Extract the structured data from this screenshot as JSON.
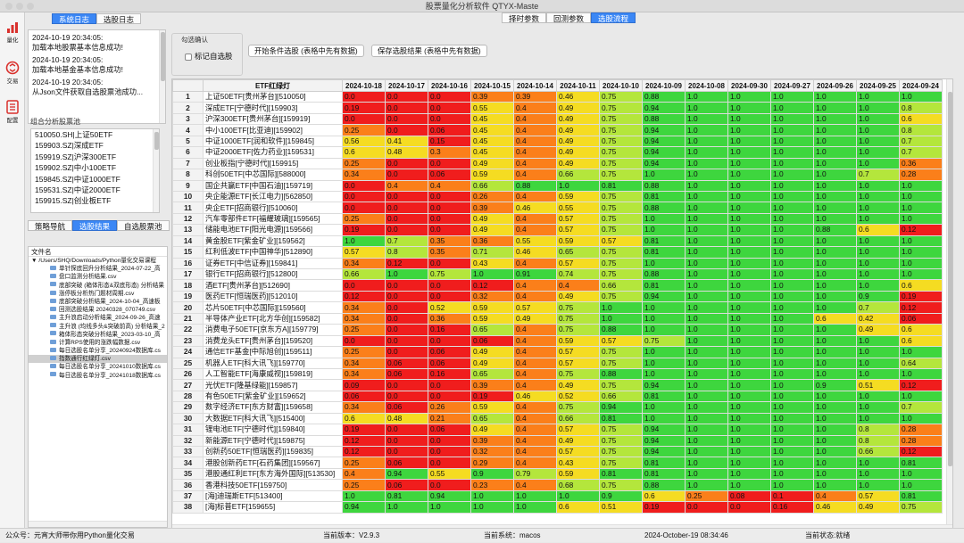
{
  "app": {
    "title": "股票量化分析软件 QTYX-Maste"
  },
  "toolbar": {
    "items": [
      {
        "label": "量化",
        "icon": "bar-chart-icon",
        "color": "#d9302c"
      },
      {
        "label": "交易",
        "icon": "trade-icon",
        "color": "#d9302c"
      },
      {
        "label": "配置",
        "icon": "config-icon",
        "color": "#d9302c"
      }
    ]
  },
  "left_tabs": {
    "tab1": "系统日志",
    "tab2": "选股日志"
  },
  "logs": [
    {
      "time": "2024-10-19 20:34:05:",
      "msg": "加载本地股票基本信息成功!"
    },
    {
      "time": "2024-10-19 20:34:05:",
      "msg": "加载本地基金基本信息成功!"
    },
    {
      "time": "2024-10-19 20:34:05:",
      "msg": "从Json文件获取自选股票池成功..."
    }
  ],
  "pool_label": "组合分析股票池",
  "pool_items": [
    "510050.SH|上证50ETF",
    "159903.SZ|深成ETF",
    "159919.SZ|沪深300ETF",
    "159902.SZ|中小100ETF",
    "159845.SZ|中证1000ETF",
    "159531.SZ|中证2000ETF",
    "159915.SZ|创业板ETF"
  ],
  "bottom_tabs": {
    "tab1": "策略导航",
    "tab2": "选股结果",
    "tab3": "自选股票池"
  },
  "file_header": "文件名",
  "file_root": "/Users/SHQ/Downloads/Python量化交易课程",
  "files": [
    "单针探底回升分析结果_2024-07-22_高",
    "盘口监测分析结果.csv",
    "底部突破 (箱体形态&双底形态) 分析结果",
    "涨停板分析热门题材周期.csv",
    "底部突破分析结果_2024-10-04_高速板",
    "回测选股结果 20240328_070749.csv",
    "主升浪启动分析结果_2024-09-26_高速",
    "主升浪 (均线多头&突破前高) 分析结果_2",
    "箱体形态突破分析结果_2023-03-10_高",
    "计算RPS使用的涨跌幅数据.csv",
    "每日选股名单分享_20240924数据库.cs",
    "指数通行红绿灯.csv",
    "每日选股名单分享_20241010数据库.cs",
    "每日选股名单分享_20241018数据库.cs"
  ],
  "selected_file_index": 11,
  "top_buttons": {
    "b1": "择时参数",
    "b2": "回测参数",
    "b3": "选股流程"
  },
  "group": {
    "title": "勾选确认",
    "checkbox": "标记自选股"
  },
  "actions": {
    "start": "开始条件选股 (表格中先有数据)",
    "save": "保存选股结果 (表格中先有数据)"
  },
  "table": {
    "name_header": "ETF红绿灯",
    "dates": [
      "2024-10-18",
      "2024-10-17",
      "2024-10-16",
      "2024-10-15",
      "2024-10-14",
      "2024-10-11",
      "2024-10-10",
      "2024-10-09",
      "2024-10-08",
      "2024-09-30",
      "2024-09-27",
      "2024-09-26",
      "2024-09-25",
      "2024-09-24"
    ],
    "rows": [
      {
        "name": "上证50ETF[贵州茅台][510050]",
        "v": [
          "0.0",
          "0.0",
          "0.0",
          "0.39",
          "0.39",
          "0.46",
          "0.75",
          "0.88",
          "1.0",
          "1.0",
          "1.0",
          "1.0",
          "1.0",
          "1.0"
        ]
      },
      {
        "name": "深成ETF[宁德时代][159903]",
        "v": [
          "0.19",
          "0.0",
          "0.0",
          "0.55",
          "0.4",
          "0.49",
          "0.75",
          "0.94",
          "1.0",
          "1.0",
          "1.0",
          "1.0",
          "1.0",
          "0.8"
        ]
      },
      {
        "name": "沪深300ETF[贵州茅台][159919]",
        "v": [
          "0.0",
          "0.0",
          "0.0",
          "0.45",
          "0.4",
          "0.49",
          "0.75",
          "0.88",
          "1.0",
          "1.0",
          "1.0",
          "1.0",
          "1.0",
          "0.6"
        ]
      },
      {
        "name": "中小100ETF[比亚迪][159902]",
        "v": [
          "0.25",
          "0.0",
          "0.06",
          "0.45",
          "0.4",
          "0.49",
          "0.75",
          "0.94",
          "1.0",
          "1.0",
          "1.0",
          "1.0",
          "1.0",
          "0.8"
        ]
      },
      {
        "name": "中证1000ETF[润和软件][159845]",
        "v": [
          "0.56",
          "0.41",
          "0.15",
          "0.45",
          "0.4",
          "0.49",
          "0.75",
          "0.94",
          "1.0",
          "1.0",
          "1.0",
          "1.0",
          "1.0",
          "0.7"
        ]
      },
      {
        "name": "中证2000ETF[佐力药业][159531]",
        "v": [
          "0.6",
          "0.48",
          "0.3",
          "0.45",
          "0.4",
          "0.49",
          "0.75",
          "0.94",
          "1.0",
          "1.0",
          "1.0",
          "1.0",
          "1.0",
          "0.7"
        ]
      },
      {
        "name": "创业板指[宁德时代][159915]",
        "v": [
          "0.25",
          "0.0",
          "0.0",
          "0.49",
          "0.4",
          "0.49",
          "0.75",
          "0.94",
          "1.0",
          "1.0",
          "1.0",
          "1.0",
          "1.0",
          "0.36"
        ]
      },
      {
        "name": "科创50ETF[中芯国际][588000]",
        "v": [
          "0.34",
          "0.0",
          "0.06",
          "0.59",
          "0.4",
          "0.66",
          "0.75",
          "1.0",
          "1.0",
          "1.0",
          "1.0",
          "1.0",
          "0.7",
          "0.28"
        ]
      },
      {
        "name": "国企共赢ETF[中国石油][159719]",
        "v": [
          "0.0",
          "0.4",
          "0.4",
          "0.66",
          "0.88",
          "1.0",
          "0.81",
          "0.88",
          "1.0",
          "1.0",
          "1.0",
          "1.0",
          "1.0",
          "1.0"
        ]
      },
      {
        "name": "央企能源ETF[长江电力][562850]",
        "v": [
          "0.0",
          "0.0",
          "0.0",
          "0.26",
          "0.4",
          "0.59",
          "0.75",
          "0.81",
          "1.0",
          "1.0",
          "1.0",
          "1.0",
          "1.0",
          "1.0"
        ]
      },
      {
        "name": "央企ETF[招商银行][510060]",
        "v": [
          "0.0",
          "0.0",
          "0.0",
          "0.39",
          "0.46",
          "0.55",
          "0.75",
          "0.88",
          "1.0",
          "1.0",
          "1.0",
          "1.0",
          "1.0",
          "1.0"
        ]
      },
      {
        "name": "汽车零部件ETF[福耀玻璃][159565]",
        "v": [
          "0.25",
          "0.0",
          "0.0",
          "0.49",
          "0.4",
          "0.57",
          "0.75",
          "1.0",
          "1.0",
          "1.0",
          "1.0",
          "1.0",
          "1.0",
          "1.0"
        ]
      },
      {
        "name": "储能电池ETF[阳光电源][159566]",
        "v": [
          "0.19",
          "0.0",
          "0.0",
          "0.49",
          "0.4",
          "0.57",
          "0.75",
          "1.0",
          "1.0",
          "1.0",
          "1.0",
          "0.88",
          "0.6",
          "0.12"
        ]
      },
      {
        "name": "黄金股ETF[紫金矿业][159562]",
        "v": [
          "1.0",
          "0.7",
          "0.35",
          "0.36",
          "0.55",
          "0.59",
          "0.57",
          "0.81",
          "1.0",
          "1.0",
          "1.0",
          "1.0",
          "1.0",
          "1.0"
        ]
      },
      {
        "name": "红利低波ETF[中国神华][512890]",
        "v": [
          "0.57",
          "0.8",
          "0.35",
          "0.71",
          "0.46",
          "0.65",
          "0.75",
          "0.81",
          "1.0",
          "1.0",
          "1.0",
          "1.0",
          "1.0",
          "1.0"
        ]
      },
      {
        "name": "证券ETF[中信证券][159841]",
        "v": [
          "0.34",
          "0.12",
          "0.0",
          "0.43",
          "0.4",
          "0.57",
          "0.75",
          "1.0",
          "1.0",
          "1.0",
          "1.0",
          "1.0",
          "1.0",
          "1.0"
        ]
      },
      {
        "name": "银行ETF[招商银行][512800]",
        "v": [
          "0.66",
          "1.0",
          "0.75",
          "1.0",
          "0.91",
          "0.74",
          "0.75",
          "0.88",
          "1.0",
          "1.0",
          "1.0",
          "1.0",
          "1.0",
          "1.0"
        ]
      },
      {
        "name": "酒ETF[贵州茅台][512690]",
        "v": [
          "0.0",
          "0.0",
          "0.0",
          "0.12",
          "0.4",
          "0.4",
          "0.66",
          "0.81",
          "1.0",
          "1.0",
          "1.0",
          "1.0",
          "1.0",
          "0.6"
        ]
      },
      {
        "name": "医药ETF[恒瑞医药][512010]",
        "v": [
          "0.12",
          "0.0",
          "0.0",
          "0.32",
          "0.4",
          "0.49",
          "0.75",
          "0.94",
          "1.0",
          "1.0",
          "1.0",
          "1.0",
          "0.9",
          "0.19"
        ]
      },
      {
        "name": "芯片50ETF[中芯国际][159560]",
        "v": [
          "0.34",
          "0.0",
          "0.52",
          "0.59",
          "0.57",
          "0.75",
          "1.0",
          "1.0",
          "1.0",
          "1.0",
          "1.0",
          "1.0",
          "0.7",
          "0.12"
        ]
      },
      {
        "name": "半导体产业ETF[北方华创][159582]",
        "v": [
          "0.34",
          "0.0",
          "0.36",
          "0.59",
          "0.49",
          "0.75",
          "1.0",
          "1.0",
          "1.0",
          "1.0",
          "1.0",
          "0.6",
          "0.42",
          "0.06"
        ]
      },
      {
        "name": "消费电子50ETF[京东方A][159779]",
        "v": [
          "0.25",
          "0.0",
          "0.16",
          "0.65",
          "0.4",
          "0.75",
          "0.88",
          "1.0",
          "1.0",
          "1.0",
          "1.0",
          "1.0",
          "0.49",
          "0.6"
        ]
      },
      {
        "name": "消费龙头ETF[贵州茅台][159520]",
        "v": [
          "0.0",
          "0.0",
          "0.0",
          "0.06",
          "0.4",
          "0.59",
          "0.57",
          "0.75",
          "1.0",
          "1.0",
          "1.0",
          "1.0",
          "1.0",
          "0.6"
        ]
      },
      {
        "name": "通信ETF基金[中际旭创][159511]",
        "v": [
          "0.25",
          "0.0",
          "0.06",
          "0.49",
          "0.4",
          "0.57",
          "0.75",
          "1.0",
          "1.0",
          "1.0",
          "1.0",
          "1.0",
          "1.0",
          "1.0"
        ]
      },
      {
        "name": "机器人ETF[科大讯飞][159770]",
        "v": [
          "0.34",
          "0.06",
          "0.06",
          "0.49",
          "0.4",
          "0.57",
          "0.75",
          "1.0",
          "1.0",
          "1.0",
          "1.0",
          "1.0",
          "1.0",
          "0.64"
        ]
      },
      {
        "name": "人工智能ETF[海康威视][159819]",
        "v": [
          "0.34",
          "0.06",
          "0.16",
          "0.65",
          "0.4",
          "0.75",
          "0.88",
          "1.0",
          "1.0",
          "1.0",
          "1.0",
          "1.0",
          "1.0",
          "1.0"
        ]
      },
      {
        "name": "光伏ETF[隆基绿能][159857]",
        "v": [
          "0.09",
          "0.0",
          "0.0",
          "0.39",
          "0.4",
          "0.49",
          "0.75",
          "0.94",
          "1.0",
          "1.0",
          "1.0",
          "0.9",
          "0.51",
          "0.12"
        ]
      },
      {
        "name": "有色50ETF[紫金矿业][159652]",
        "v": [
          "0.06",
          "0.0",
          "0.0",
          "0.19",
          "0.46",
          "0.52",
          "0.66",
          "0.81",
          "1.0",
          "1.0",
          "1.0",
          "1.0",
          "1.0",
          "1.0"
        ]
      },
      {
        "name": "数字经济ETF[东方财富][159658]",
        "v": [
          "0.34",
          "0.06",
          "0.26",
          "0.59",
          "0.4",
          "0.75",
          "0.94",
          "1.0",
          "1.0",
          "1.0",
          "1.0",
          "1.0",
          "1.0",
          "0.7"
        ]
      },
      {
        "name": "大数据ETF[科大讯飞][515400]",
        "v": [
          "0.6",
          "0.48",
          "0.21",
          "0.65",
          "0.4",
          "0.66",
          "0.81",
          "1.0",
          "1.0",
          "1.0",
          "1.0",
          "1.0",
          "1.0",
          "1.0"
        ]
      },
      {
        "name": "锂电池ETF[宁德时代][159840]",
        "v": [
          "0.19",
          "0.0",
          "0.06",
          "0.49",
          "0.4",
          "0.57",
          "0.75",
          "0.94",
          "1.0",
          "1.0",
          "1.0",
          "1.0",
          "0.8",
          "0.28"
        ]
      },
      {
        "name": "新能源ETF[宁德时代][159875]",
        "v": [
          "0.12",
          "0.0",
          "0.0",
          "0.39",
          "0.4",
          "0.49",
          "0.75",
          "0.94",
          "1.0",
          "1.0",
          "1.0",
          "1.0",
          "0.8",
          "0.28"
        ]
      },
      {
        "name": "创新药50ETF[恒瑞医药][159835]",
        "v": [
          "0.12",
          "0.0",
          "0.0",
          "0.32",
          "0.4",
          "0.57",
          "0.75",
          "0.94",
          "1.0",
          "1.0",
          "1.0",
          "1.0",
          "0.66",
          "0.12"
        ]
      },
      {
        "name": "港股创新药ETF[石药集团][159567]",
        "v": [
          "0.25",
          "0.06",
          "0.0",
          "0.29",
          "0.4",
          "0.43",
          "0.75",
          "0.81",
          "1.0",
          "1.0",
          "1.0",
          "1.0",
          "1.0",
          "0.81"
        ]
      },
      {
        "name": "港股通红利ETF[东方海外国际][513530]",
        "v": [
          "0.4",
          "0.94",
          "0.55",
          "0.9",
          "0.79",
          "0.59",
          "0.81",
          "0.81",
          "1.0",
          "1.0",
          "1.0",
          "1.0",
          "1.0",
          "1.0"
        ]
      },
      {
        "name": "香港科技50ETF[159750]",
        "v": [
          "0.25",
          "0.06",
          "0.0",
          "0.23",
          "0.4",
          "0.68",
          "0.75",
          "0.88",
          "1.0",
          "1.0",
          "1.0",
          "1.0",
          "1.0",
          "1.0"
        ]
      },
      {
        "name": "[海]迪瑞斯ETF[513400]",
        "v": [
          "1.0",
          "0.81",
          "0.94",
          "1.0",
          "1.0",
          "1.0",
          "0.9",
          "0.6",
          "0.25",
          "0.08",
          "0.1",
          "0.4",
          "0.57",
          "0.81"
        ]
      },
      {
        "name": "[海]标普ETF[159655]",
        "v": [
          "0.94",
          "1.0",
          "1.0",
          "1.0",
          "1.0",
          "0.6",
          "0.51",
          "0.19",
          "0.0",
          "0.0",
          "0.16",
          "0.46",
          "0.49",
          "0.75"
        ]
      }
    ]
  },
  "status": {
    "wechat": "公众号：元宵大师带你用Python量化交易",
    "version": "当前版本：V2.9.3",
    "system": "当前系统：macos",
    "time": "2024-October-19 08:34:46",
    "state": "当前状态:就绪"
  }
}
